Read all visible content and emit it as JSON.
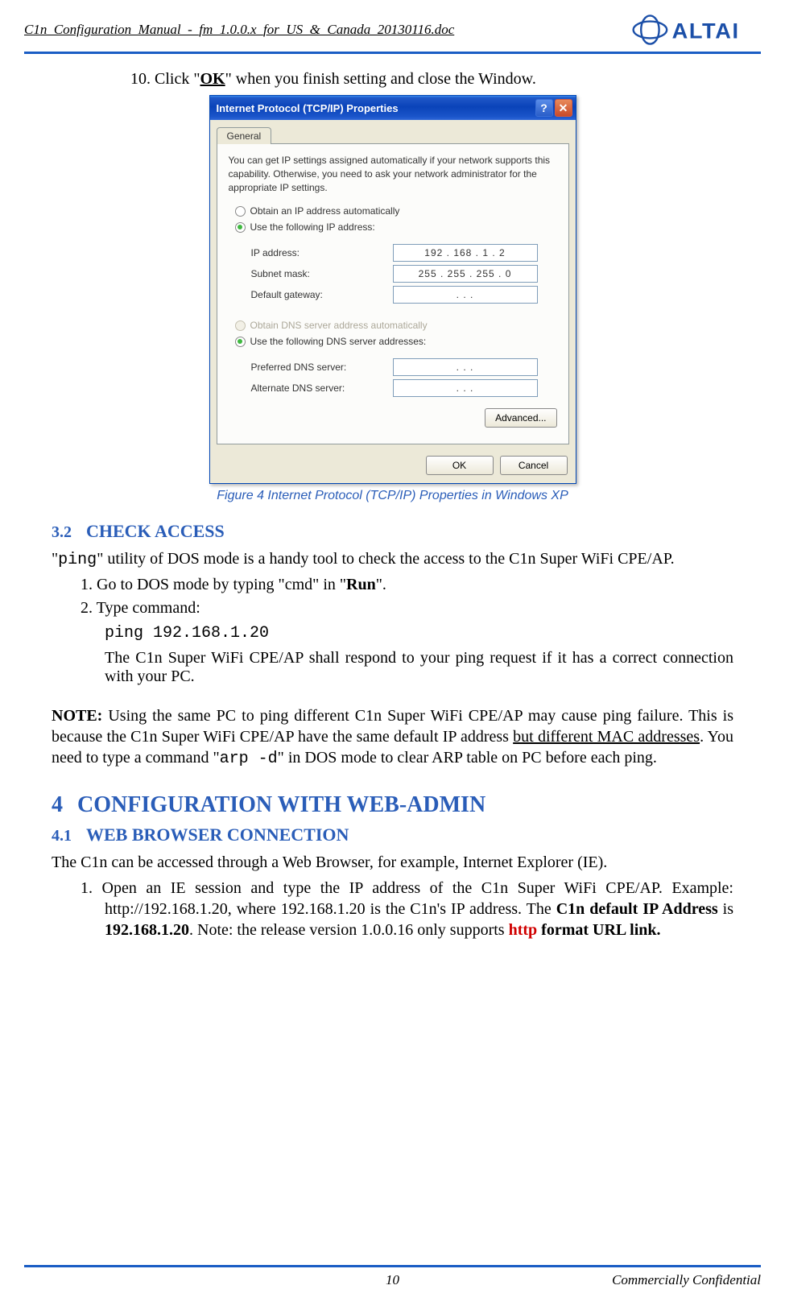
{
  "header": {
    "doc_title": "C1n_Configuration_Manual_-_fm_1.0.0.x_for_US_&_Canada_20130116.doc",
    "logo_text": "ALTAI"
  },
  "step10": {
    "prefix": "10. Click \"",
    "ok": "OK",
    "suffix": "\" when you finish setting and close the Window."
  },
  "dialog": {
    "title": "Internet Protocol (TCP/IP) Properties",
    "tab": "General",
    "description": "You can get IP settings assigned automatically if your network supports this capability. Otherwise, you need to ask your network administrator for the appropriate IP settings.",
    "radio_auto_ip": "Obtain an IP address automatically",
    "radio_use_ip": "Use the following IP address:",
    "fields": {
      "ip_label": "IP address:",
      "ip_value": "192 . 168 .   1  .   2",
      "subnet_label": "Subnet mask:",
      "subnet_value": "255 . 255 . 255 .   0",
      "gateway_label": "Default gateway:",
      "gateway_value": ".        .        ."
    },
    "radio_auto_dns": "Obtain DNS server address automatically",
    "radio_use_dns": "Use the following DNS server addresses:",
    "dns_fields": {
      "preferred_label": "Preferred DNS server:",
      "preferred_value": ".        .        .",
      "alternate_label": "Alternate DNS server:",
      "alternate_value": ".        .        ."
    },
    "advanced_btn": "Advanced...",
    "ok_btn": "OK",
    "cancel_btn": "Cancel"
  },
  "figure_caption": "Figure 4    Internet Protocol (TCP/IP) Properties in Windows XP",
  "sec32": {
    "num": "3.2",
    "title": "CHECK ACCESS"
  },
  "para32": {
    "p1_a": "\"",
    "p1_b": "ping",
    "p1_c": "\" utility of DOS mode is a handy tool to check the access to the C1n Super WiFi CPE/AP.",
    "li1_a": "1.   Go to DOS mode by typing \"cmd\" in \"",
    "li1_b": "Run",
    "li1_c": "\".",
    "li2": "2.   Type command:",
    "cmd": "ping 192.168.1.20",
    "resp": "The C1n Super WiFi CPE/AP shall respond to your ping request if it has a correct connection with your PC."
  },
  "note": {
    "label": "NOTE:",
    "a": " Using the same PC to ping different C1n Super WiFi CPE/AP may cause ping failure. This is because the C1n Super WiFi CPE/AP have the same default IP address ",
    "u": "but different MAC addresses",
    "b": ". You need to type a command \"",
    "cmd": "arp -d",
    "c": "\" in DOS mode to clear ARP table on PC before each ping."
  },
  "sec4": {
    "num": "4",
    "title": "CONFIGURATION WITH WEB-ADMIN"
  },
  "sec41": {
    "num": "4.1",
    "title": "WEB BROWSER CONNECTION"
  },
  "para41": {
    "intro": "The C1n can be accessed through a Web Browser, for example, Internet Explorer (IE).",
    "li1_a": "1.    Open an IE session and type the IP address of the C1n Super WiFi CPE/AP. Example: http://192.168.1.20, where 192.168.1.20 is the C1n's IP address. The ",
    "li1_b": "C1n default IP Address",
    "li1_c": " is ",
    "li1_d": "192.168.1.20",
    "li1_e": ". Note: the release version 1.0.0.16 only supports ",
    "li1_f": "http",
    "li1_g": " format URL link."
  },
  "footer": {
    "page_no": "10",
    "confidential": "Commercially Confidential"
  }
}
